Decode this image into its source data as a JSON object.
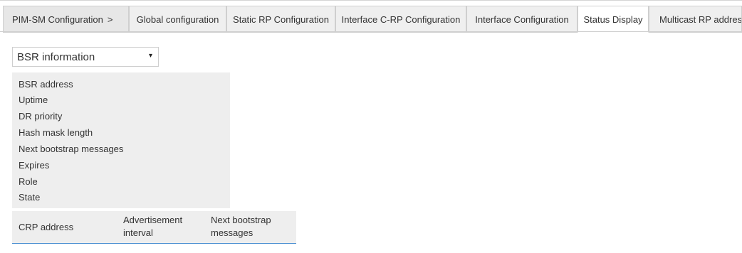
{
  "tabs": [
    {
      "label": "PIM-SM Configuration",
      "separator": ">"
    },
    {
      "label": "Global configuration"
    },
    {
      "label": "Static RP Configuration"
    },
    {
      "label": "Interface C-RP Configuration"
    },
    {
      "label": "Interface Configuration"
    },
    {
      "label": "Status Display",
      "active": true
    },
    {
      "label": "Multicast RP address"
    }
  ],
  "select": {
    "value": "BSR information",
    "arrow": "▾"
  },
  "bsr_fields": [
    "BSR address",
    "Uptime",
    "DR priority",
    "Hash mask length",
    "Next bootstrap messages",
    "Expires",
    "Role",
    "State"
  ],
  "crp_table": {
    "columns": [
      {
        "line1": "CRP address",
        "line2": ""
      },
      {
        "line1": "Advertisement",
        "line2": "interval"
      },
      {
        "line1": "Next bootstrap",
        "line2": "messages"
      }
    ]
  },
  "colors": {
    "accent_line": "#4a8fd1",
    "panel_bg": "#eeeeee"
  }
}
